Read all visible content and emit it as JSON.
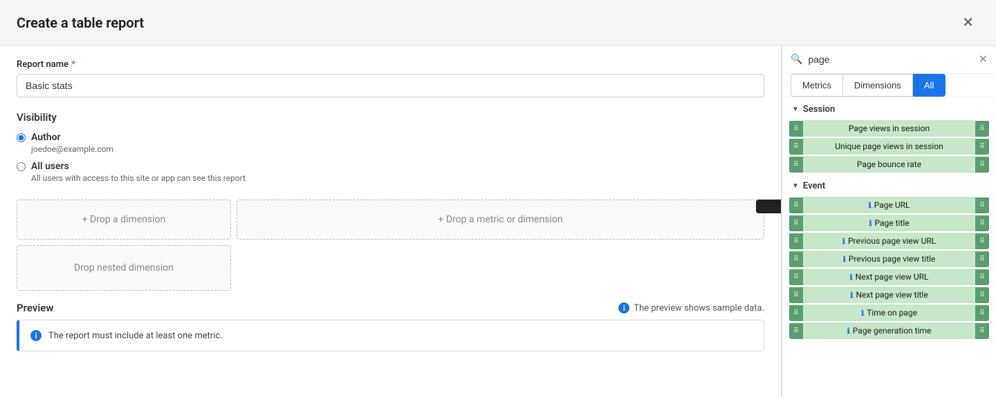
{
  "header": {
    "title": "Create a table report",
    "close_label": "✕"
  },
  "form": {
    "report_name_label": "Report name",
    "report_name_value": "Basic stats",
    "report_name_placeholder": "Basic stats"
  },
  "visibility": {
    "title": "Visibility",
    "author_label": "Author",
    "author_email": "joedoe@example.com",
    "all_users_label": "All users",
    "all_users_desc": "All users with access to this site or app can see this report"
  },
  "drop_zones": {
    "dimension": "+ Drop a dimension",
    "metric": "+ Drop a metric or dimension",
    "nested": "Drop nested dimension"
  },
  "preview": {
    "title": "Preview",
    "note": "The preview shows sample data.",
    "message": "The report must include at least one metric."
  },
  "search": {
    "value": "page",
    "placeholder": "Search",
    "clear_label": "✕"
  },
  "filter_tabs": {
    "metrics": "Metrics",
    "dimensions": "Dimensions",
    "all": "All"
  },
  "right_panel": {
    "session_section": "Session",
    "event_section": "Event",
    "session_items": [
      {
        "label": "Page views in session",
        "type": "metric"
      },
      {
        "label": "Unique page views in session",
        "type": "metric"
      },
      {
        "label": "Page bounce rate",
        "type": "metric"
      }
    ],
    "event_items": [
      {
        "label": "Page URL",
        "type": "dim",
        "icon": true
      },
      {
        "label": "Page title",
        "type": "dim",
        "icon": true
      },
      {
        "label": "Previous page view URL",
        "type": "dim",
        "icon": true
      },
      {
        "label": "Previous page view title",
        "type": "dim",
        "icon": true
      },
      {
        "label": "Next page view URL",
        "type": "dim",
        "icon": true
      },
      {
        "label": "Next page view title",
        "type": "dim",
        "icon": true
      },
      {
        "label": "Time on page",
        "type": "dim",
        "icon": true
      },
      {
        "label": "Page generation time",
        "type": "dim",
        "icon": true
      }
    ]
  },
  "colors": {
    "accent": "#1a73e8",
    "green_item": "#5a9e6f",
    "green_bg": "#c8e6c9"
  }
}
